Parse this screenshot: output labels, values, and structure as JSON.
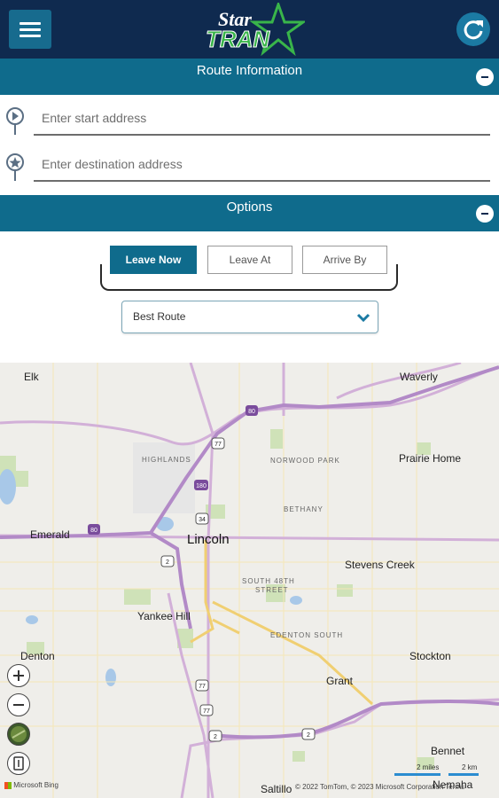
{
  "header": {
    "logo_text_top": "Star",
    "logo_text_bottom": "TRAN"
  },
  "route_info": {
    "title": "Route Information",
    "start_placeholder": "Enter start address",
    "destination_placeholder": "Enter destination address"
  },
  "options": {
    "title": "Options",
    "time_buttons": [
      "Leave Now",
      "Leave At",
      "Arrive By"
    ],
    "selected_time_button": "Leave Now",
    "route_type": "Best Route"
  },
  "map": {
    "places": [
      "Elk",
      "Waverly",
      "Prairie Home",
      "Emerald",
      "Lincoln",
      "Stevens Creek",
      "Yankee Hill",
      "Denton",
      "Stockton",
      "Grant",
      "Bennet",
      "Saltillo",
      "Nemaha"
    ],
    "neighborhoods": [
      "HIGHLANDS",
      "NORWOOD PARK",
      "BETHANY",
      "SOUTH 48TH",
      "STREET",
      "EDENTON SOUTH"
    ],
    "road_shields": [
      "80",
      "77",
      "180",
      "34",
      "80",
      "2",
      "77",
      "77",
      "2",
      "2"
    ],
    "attribution_brand": "Microsoft Bing",
    "copyright": "© 2022 TomTom, © 2023 Microsoft Corporation  Terms",
    "scale_miles": "2 miles",
    "scale_km": "2 km"
  },
  "colors": {
    "header_bg": "#0f2a4f",
    "section_bar": "#0f6b8c",
    "accent": "#1b7aa3",
    "logo_green": "#39b54a"
  }
}
